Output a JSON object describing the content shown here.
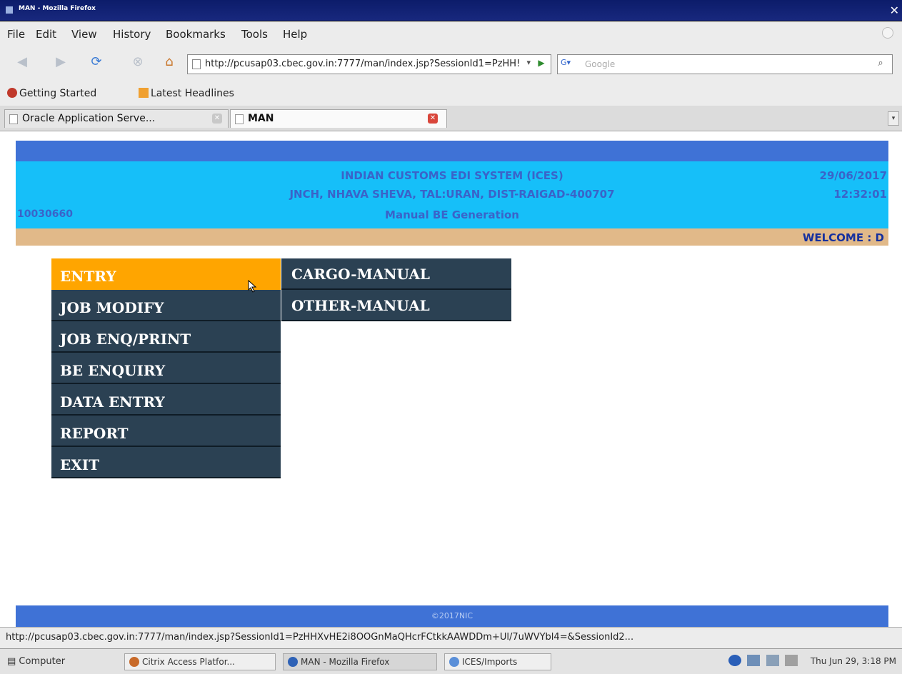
{
  "window": {
    "title": "MAN - Mozilla Firefox"
  },
  "menubar": {
    "items": [
      "File",
      "Edit",
      "View",
      "History",
      "Bookmarks",
      "Tools",
      "Help"
    ]
  },
  "nav": {
    "url": "http://pcusap03.cbec.gov.in:7777/man/index.jsp?SessionId1=PzHH!",
    "search_placeholder": "Google"
  },
  "bookmarks": {
    "items": [
      "Getting Started",
      "Latest Headlines"
    ]
  },
  "tabs": [
    {
      "label": "Oracle Application Serve..."
    },
    {
      "label": "MAN"
    }
  ],
  "header": {
    "system": "INDIAN CUSTOMS EDI SYSTEM (ICES)",
    "location": "JNCH, NHAVA SHEVA, TAL:URAN, DIST-RAIGAD-400707",
    "module": "Manual BE Generation",
    "user_id": "10030660",
    "date": "29/06/2017",
    "time": "12:32:01",
    "welcome": "WELCOME : D"
  },
  "menu": {
    "items": [
      "ENTRY",
      "JOB MODIFY",
      "JOB ENQ/PRINT",
      "BE ENQUIRY",
      "DATA ENTRY",
      "REPORT",
      "EXIT"
    ],
    "active": "ENTRY"
  },
  "submenu": {
    "items": [
      "CARGO-MANUAL",
      "OTHER-MANUAL"
    ]
  },
  "footer": {
    "copyright": "©2017NIC"
  },
  "status": {
    "text": "http://pcusap03.cbec.gov.in:7777/man/index.jsp?SessionId1=PzHHXvHE2i8OOGnMaQHcrFCtkkAAWDDm+Ul/7uWVYbl4=&SessionId2..."
  },
  "taskbar": {
    "computer": "Computer",
    "tasks": [
      "Citrix Access Platfor...",
      "MAN - Mozilla Firefox",
      "ICES/Imports"
    ],
    "clock": "Thu Jun 29, 3:18 PM"
  },
  "colors": {
    "header_blue": "#3f72d6",
    "header_cyan": "#16bff9",
    "header_tan": "#e1b989",
    "menu_dark": "#2b4153",
    "menu_active": "#ffa500"
  }
}
